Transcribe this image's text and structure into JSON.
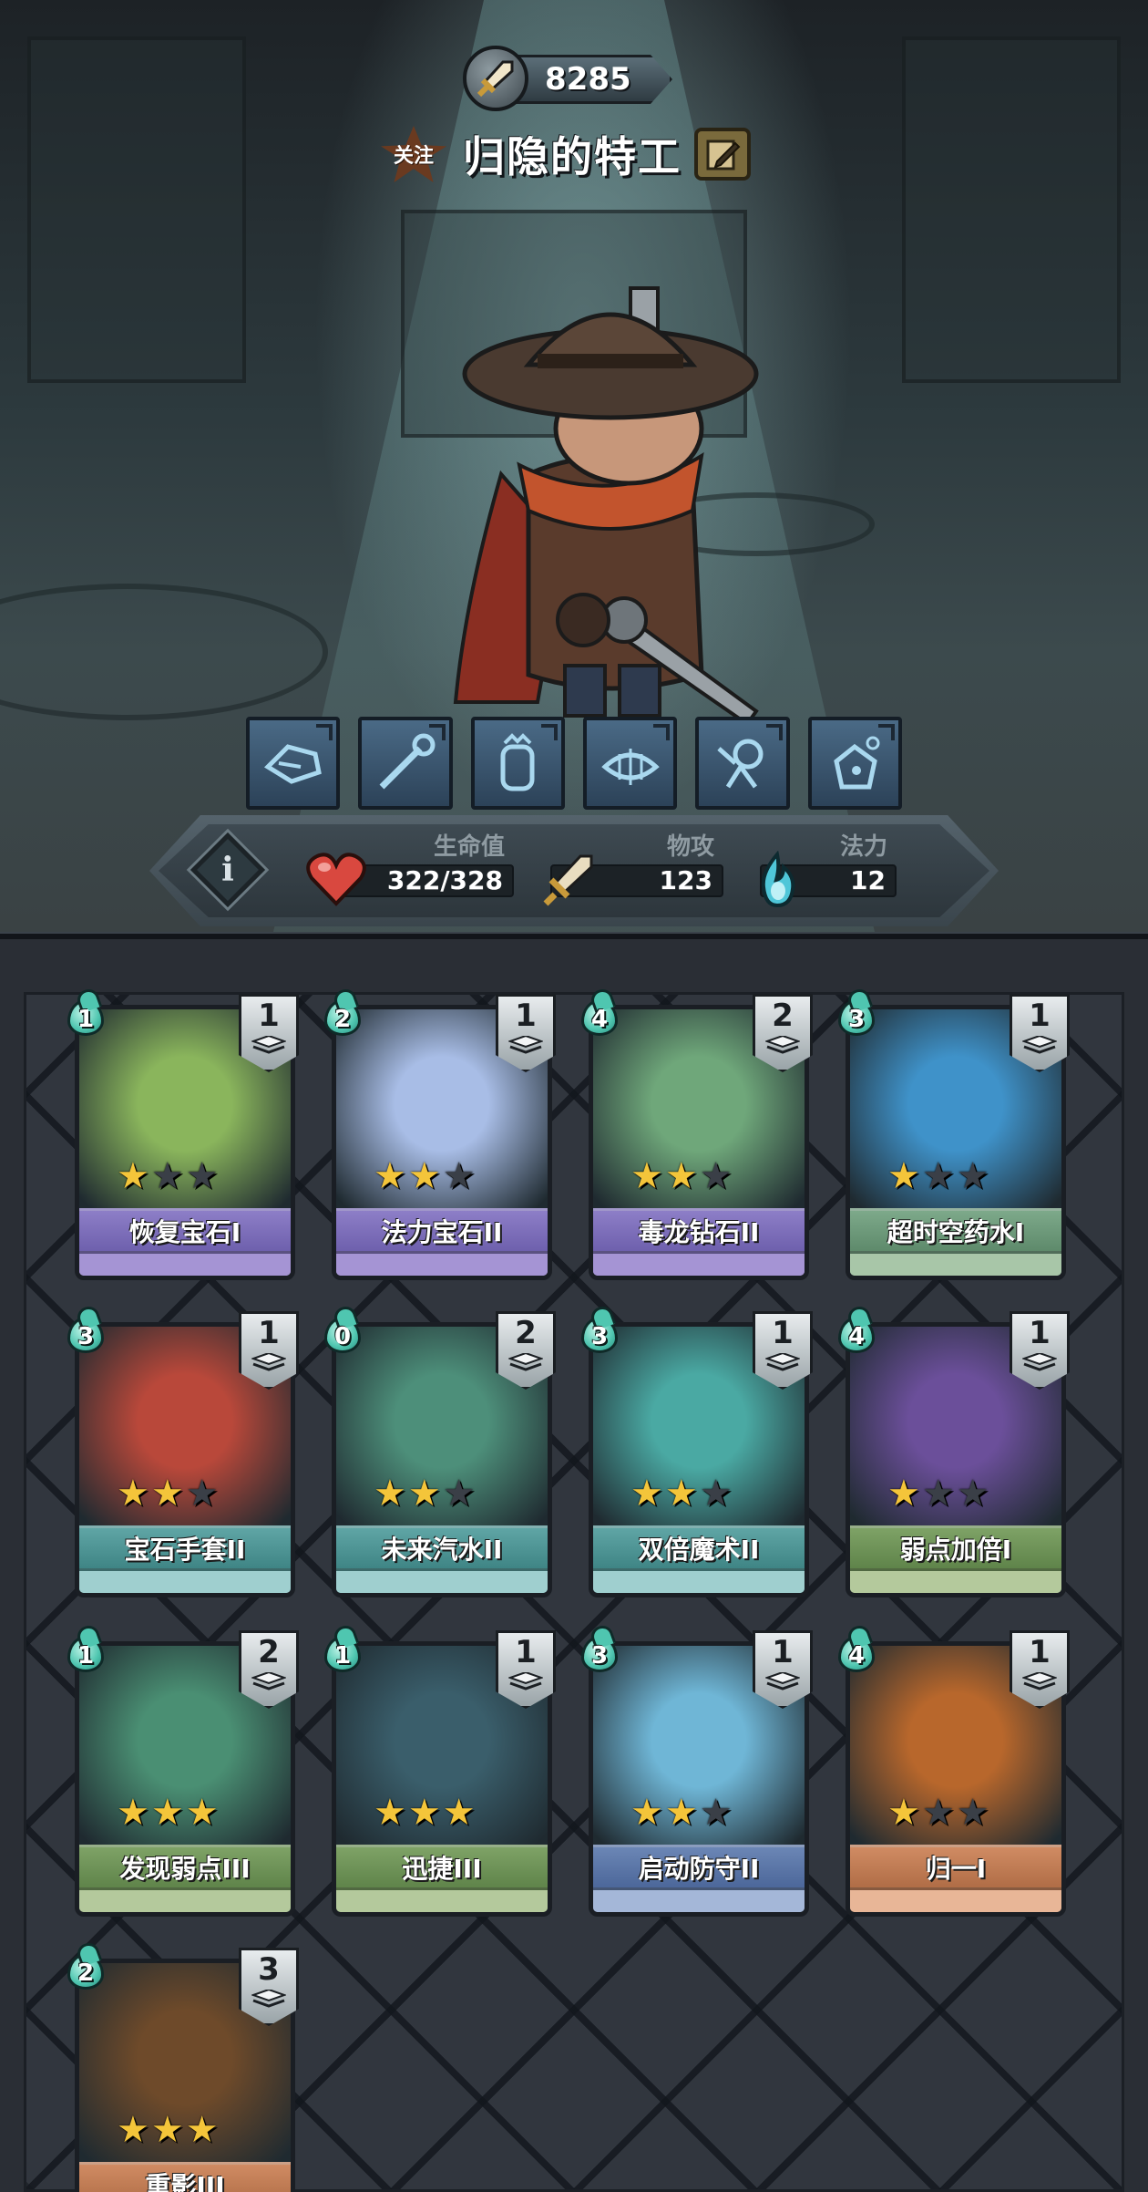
{
  "header": {
    "power_value": "8285",
    "follow_label": "关注",
    "player_name": "归隐的特工"
  },
  "character": {
    "name_icon": "gunslinger-cowboy-character"
  },
  "skills": [
    {
      "icon": "gauntlet-icon"
    },
    {
      "icon": "wrench-icon"
    },
    {
      "icon": "idol-icon"
    },
    {
      "icon": "fish-bones-icon"
    },
    {
      "icon": "punching-figure-icon"
    },
    {
      "icon": "potion-bag-icon"
    }
  ],
  "stats": {
    "info_label": "i",
    "hp": {
      "label": "生命值",
      "value": "322/328",
      "icon": "heart-icon",
      "color": "#d9483f"
    },
    "attack": {
      "label": "物攻",
      "value": "123",
      "icon": "sword-icon"
    },
    "mana": {
      "label": "法力",
      "value": "12",
      "icon": "blue-flame-icon",
      "color": "#4fc6d8"
    }
  },
  "cards": [
    {
      "cost": "1",
      "count": "1",
      "name": "恢复宝石I",
      "stars": 1,
      "theme": "purple",
      "art_color": "#8ab55c"
    },
    {
      "cost": "2",
      "count": "1",
      "name": "法力宝石II",
      "stars": 2,
      "theme": "purple",
      "art_color": "#a8bde6"
    },
    {
      "cost": "4",
      "count": "2",
      "name": "毒龙钻石II",
      "stars": 2,
      "theme": "purple",
      "art_color": "#6fa77a"
    },
    {
      "cost": "3",
      "count": "1",
      "name": "超时空药水I",
      "stars": 1,
      "theme": "green",
      "art_color": "#3f92c9"
    },
    {
      "cost": "3",
      "count": "1",
      "name": "宝石手套II",
      "stars": 2,
      "theme": "teal",
      "art_color": "#b9483a"
    },
    {
      "cost": "0",
      "count": "2",
      "name": "未来汽水II",
      "stars": 2,
      "theme": "teal",
      "art_color": "#4d8f7a"
    },
    {
      "cost": "3",
      "count": "1",
      "name": "双倍魔术II",
      "stars": 2,
      "theme": "teal",
      "art_color": "#4aa9a3"
    },
    {
      "cost": "4",
      "count": "1",
      "name": "弱点加倍I",
      "stars": 1,
      "theme": "olive",
      "art_color": "#6b4f9a"
    },
    {
      "cost": "1",
      "count": "2",
      "name": "发现弱点III",
      "stars": 3,
      "theme": "olive",
      "art_color": "#4a8f73"
    },
    {
      "cost": "1",
      "count": "1",
      "name": "迅捷III",
      "stars": 3,
      "theme": "olive",
      "art_color": "#3a5e6b"
    },
    {
      "cost": "3",
      "count": "1",
      "name": "启动防守II",
      "stars": 2,
      "theme": "blue",
      "art_color": "#6fb6d6"
    },
    {
      "cost": "4",
      "count": "1",
      "name": "归一I",
      "stars": 1,
      "theme": "orange",
      "art_color": "#b8672c"
    },
    {
      "cost": "2",
      "count": "3",
      "name": "重影III",
      "stars": 3,
      "theme": "orange",
      "art_color": "#6e4a2a"
    }
  ]
}
